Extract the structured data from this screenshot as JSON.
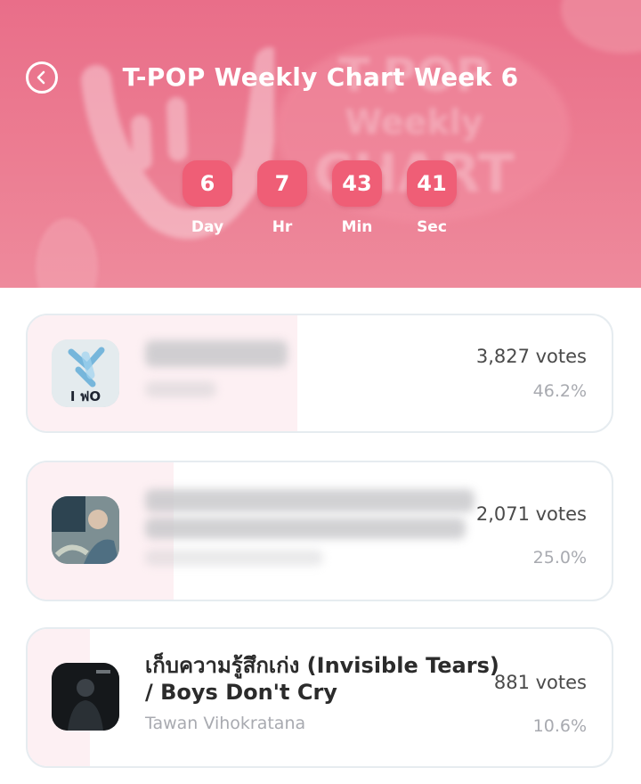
{
  "header": {
    "title": "T-POP Weekly Chart Week 6",
    "back_icon": "chevron-left-icon",
    "background_text": [
      "T-POP",
      "Weekly",
      "CHART"
    ]
  },
  "countdown": [
    {
      "value": "6",
      "label": "Day"
    },
    {
      "value": "7",
      "label": "Hr"
    },
    {
      "value": "43",
      "label": "Min"
    },
    {
      "value": "41",
      "label": "Sec"
    }
  ],
  "entries": [
    {
      "title": "",
      "artist": "",
      "votes": "3,827 votes",
      "percent": "46.2%",
      "share": 0.462,
      "thumb_text": "I ฟO"
    },
    {
      "title": "",
      "artist": "",
      "votes": "2,071 votes",
      "percent": "25.0%",
      "share": 0.25,
      "thumb_text": ""
    },
    {
      "title": "เก็บความรู้สึกเก่ง (Invisible Tears) / Boys Don't Cry",
      "artist": "Tawan Vihokratana",
      "votes": "881 votes",
      "percent": "10.6%",
      "share": 0.106,
      "thumb_text": ""
    }
  ],
  "colors": {
    "header": "#ec7d92",
    "countdown_box": "#ef5e76",
    "progress_fill": "#fdf0f3",
    "card_border": "#e6ecf0"
  }
}
